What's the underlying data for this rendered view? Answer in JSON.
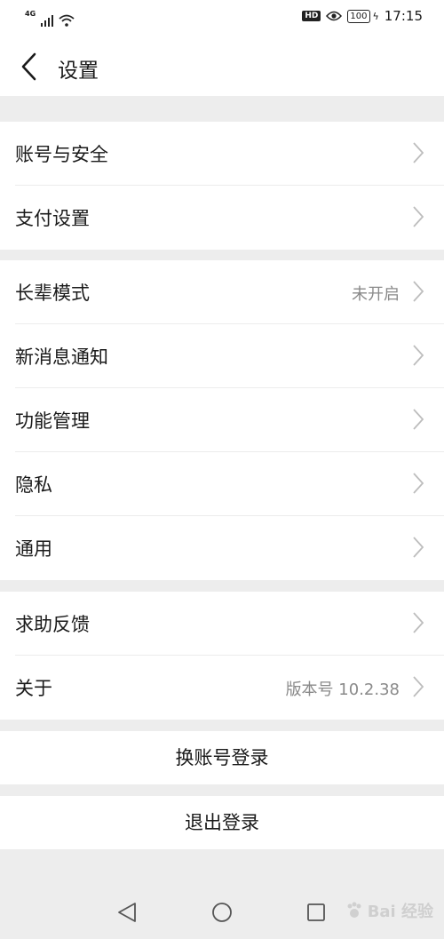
{
  "status_bar": {
    "network": "4G",
    "hd": "HD",
    "battery": "100",
    "time": "17:15"
  },
  "header": {
    "title": "设置"
  },
  "groups": [
    {
      "items": [
        {
          "label": "账号与安全",
          "value": ""
        },
        {
          "label": "支付设置",
          "value": ""
        }
      ]
    },
    {
      "items": [
        {
          "label": "长辈模式",
          "value": "未开启"
        },
        {
          "label": "新消息通知",
          "value": ""
        },
        {
          "label": "功能管理",
          "value": ""
        },
        {
          "label": "隐私",
          "value": ""
        },
        {
          "label": "通用",
          "value": ""
        }
      ]
    },
    {
      "items": [
        {
          "label": "求助反馈",
          "value": ""
        },
        {
          "label": "关于",
          "value": "版本号 10.2.38"
        }
      ]
    }
  ],
  "actions": {
    "switch_account": "换账号登录",
    "logout": "退出登录"
  },
  "watermark": {
    "text": "Bai 经验"
  },
  "icons": {
    "back": "chevron-left-icon",
    "row": "chevron-right-icon",
    "sys_back": "triangle-back-icon",
    "sys_home": "circle-home-icon",
    "sys_recent": "square-recent-icon"
  }
}
